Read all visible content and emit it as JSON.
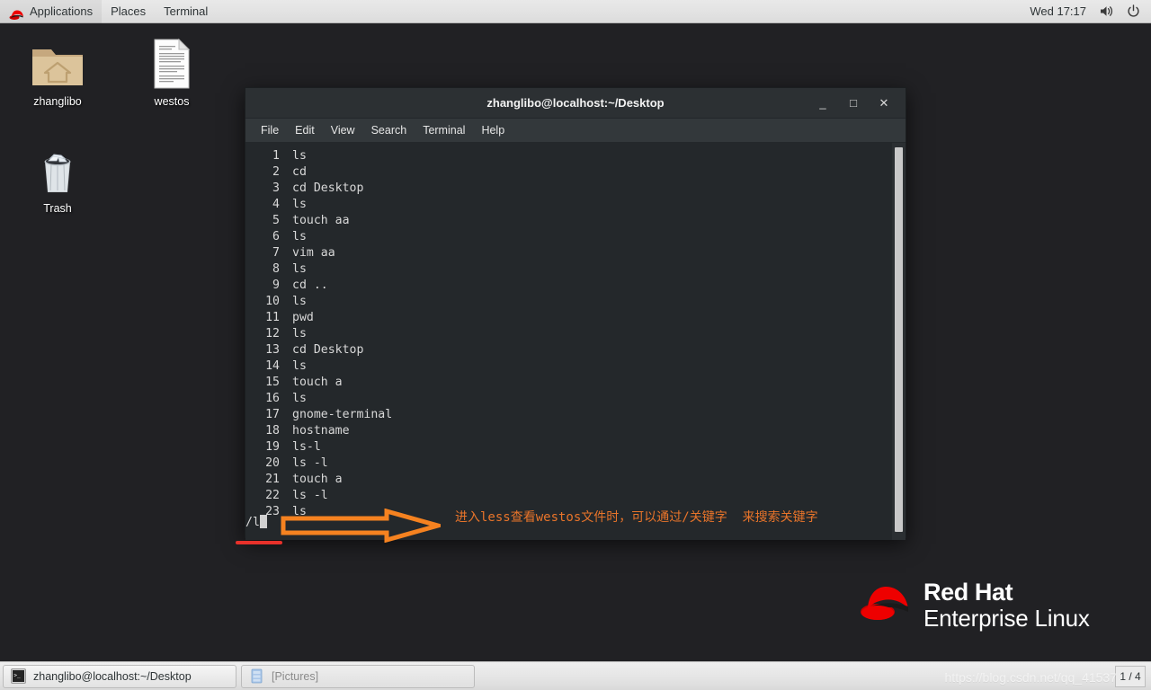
{
  "top_panel": {
    "logo_icon": "redhat-logo-icon",
    "menus": [
      {
        "label": "Applications",
        "name": "applications-menu"
      },
      {
        "label": "Places",
        "name": "places-menu"
      },
      {
        "label": "Terminal",
        "name": "terminal-menu"
      }
    ],
    "clock": "Wed 17:17",
    "volume_icon": "volume-icon",
    "power_icon": "power-icon"
  },
  "desktop": {
    "icons": [
      {
        "label": "zhanglibo",
        "icon": "home-folder-icon"
      },
      {
        "label": "westos",
        "icon": "text-document-icon"
      },
      {
        "label": "Trash",
        "icon": "trash-can-icon"
      }
    ],
    "brand": {
      "line1": "Red Hat",
      "line2": "Enterprise Linux",
      "logo_icon": "redhat-fedora-logo-icon",
      "logo_color": "#ee0000"
    }
  },
  "terminal": {
    "title": "zhanglibo@localhost:~/Desktop",
    "menu": [
      "File",
      "Edit",
      "View",
      "Search",
      "Terminal",
      "Help"
    ],
    "window_buttons": {
      "minimize": "_",
      "maximize": "□",
      "close": "✕"
    },
    "history": [
      {
        "n": "1",
        "cmd": "ls"
      },
      {
        "n": "2",
        "cmd": "cd"
      },
      {
        "n": "3",
        "cmd": "cd Desktop"
      },
      {
        "n": "4",
        "cmd": "ls"
      },
      {
        "n": "5",
        "cmd": "touch aa"
      },
      {
        "n": "6",
        "cmd": "ls"
      },
      {
        "n": "7",
        "cmd": "vim aa"
      },
      {
        "n": "8",
        "cmd": "ls"
      },
      {
        "n": "9",
        "cmd": "cd .."
      },
      {
        "n": "10",
        "cmd": "ls"
      },
      {
        "n": "11",
        "cmd": "pwd"
      },
      {
        "n": "12",
        "cmd": "ls"
      },
      {
        "n": "13",
        "cmd": "cd Desktop"
      },
      {
        "n": "14",
        "cmd": "ls"
      },
      {
        "n": "15",
        "cmd": "touch a"
      },
      {
        "n": "16",
        "cmd": "ls"
      },
      {
        "n": "17",
        "cmd": "gnome-terminal"
      },
      {
        "n": "18",
        "cmd": "hostname"
      },
      {
        "n": "19",
        "cmd": "ls-l"
      },
      {
        "n": "20",
        "cmd": "ls -l"
      },
      {
        "n": "21",
        "cmd": "touch a"
      },
      {
        "n": "22",
        "cmd": "ls -l"
      },
      {
        "n": "23",
        "cmd": "ls"
      }
    ],
    "prompt": "/l",
    "colors": {
      "background": "#24282b",
      "foreground": "#d8d8d8",
      "titlebar": "#2c3033"
    }
  },
  "annotations": {
    "arrow_icon": "right-arrow-annotation-icon",
    "arrow_color": "#f58220",
    "text": "进入less查看westos文件时，可以通过/关键字  来搜索关键字",
    "underline_color": "#e8312a"
  },
  "bottom_panel": {
    "tasks": [
      {
        "label": "zhanglibo@localhost:~/Desktop",
        "icon": "terminal-icon",
        "active": true
      },
      {
        "label": "[Pictures]",
        "icon": "file-manager-icon",
        "active": false
      }
    ],
    "watermark": "https://blog.csdn.net/qq_41537",
    "workspace": "1 / 4"
  }
}
